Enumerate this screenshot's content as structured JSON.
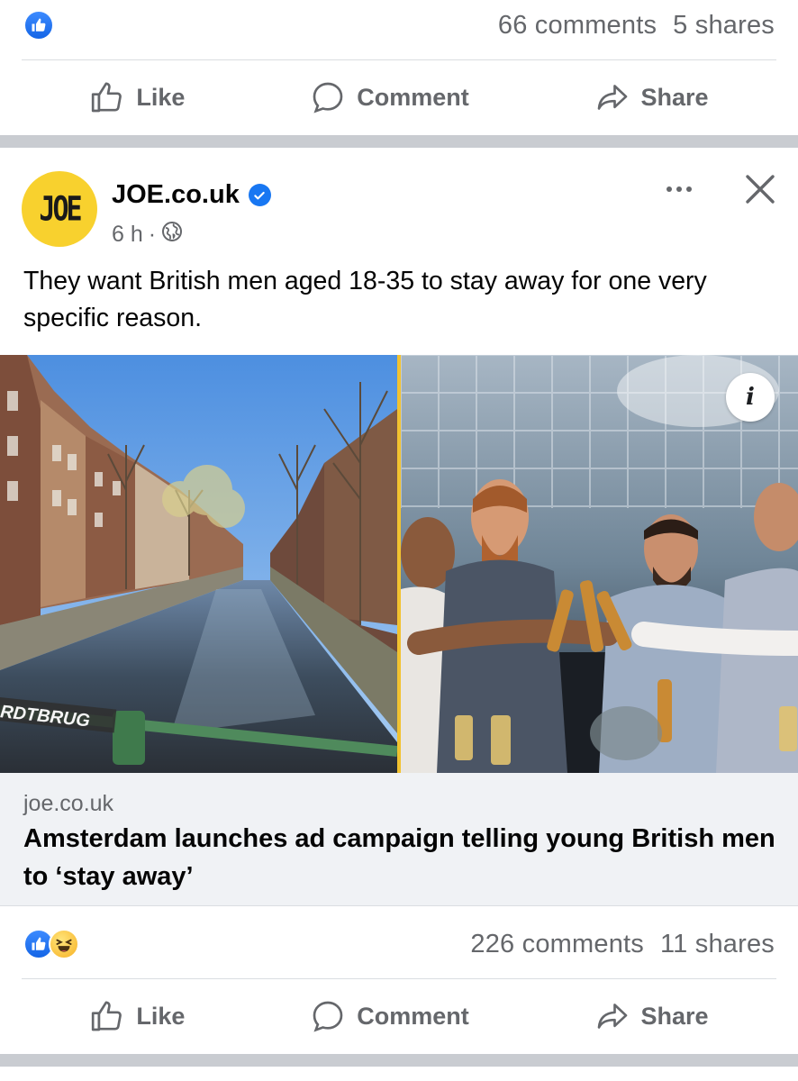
{
  "top_post": {
    "comments": "66 comments",
    "shares": "5 shares",
    "actions": {
      "like": "Like",
      "comment": "Comment",
      "share": "Share"
    }
  },
  "post": {
    "avatar_text": "JOE",
    "page_name": "JOE.co.uk",
    "time": "6 h",
    "meta_sep": "·",
    "text": "They want British men aged 18-35 to stay away for one very specific reason.",
    "image_sign": "RDTBRUG",
    "info_label": "i",
    "link": {
      "domain": "joe.co.uk",
      "title": "Amsterdam launches ad campaign telling young British men to ‘stay away’"
    },
    "comments": "226 comments",
    "shares": "11 shares",
    "actions": {
      "like": "Like",
      "comment": "Comment",
      "share": "Share"
    }
  },
  "colors": {
    "like_blue": "#1877f2",
    "muted_text": "#65676b",
    "avatar_yellow": "#f8d12e",
    "separator": "#c9ccd1"
  }
}
